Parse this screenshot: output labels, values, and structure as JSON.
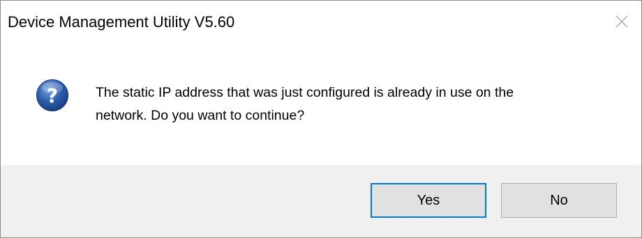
{
  "dialog": {
    "title": "Device Management Utility V5.60",
    "close_icon": "close-icon",
    "message_line1": "The static IP address that was just configured is already in use on the",
    "message_line2": "network. Do you want to continue?",
    "icon": "question-icon",
    "buttons": {
      "yes_label": "Yes",
      "no_label": "No"
    }
  },
  "colors": {
    "focus_border": "#0078d7",
    "footer_bg": "#f0f0f0",
    "button_bg": "#e1e1e1",
    "icon_blue": "#2a5aa8"
  }
}
